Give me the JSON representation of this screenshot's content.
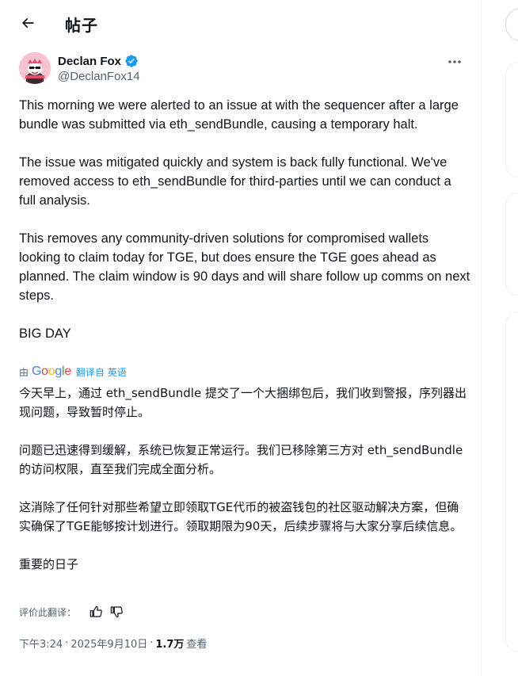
{
  "header": {
    "title": "帖子"
  },
  "author": {
    "display_name": "Declan Fox",
    "handle": "@DeclanFox14",
    "verified": true
  },
  "tweet": {
    "original_paragraphs": [
      "This morning we were alerted to an issue at with the sequencer after a large bundle was submitted via eth_sendBundle, causing a temporary halt.",
      "The issue was mitigated quickly and system is back fully functional. We've removed access to eth_sendBundle for third-parties until we can conduct a full analysis.",
      "This removes any community-driven solutions for compromised wallets looking to claim today for TGE, but does ensure the TGE goes ahead as planned. The claim window is 90 days and will share follow up comms on next steps.",
      "BIG DAY"
    ],
    "translated_by_label": "由",
    "google_text": "Google",
    "translate_from_link": "翻译自 英语",
    "translated_paragraphs": [
      "今天早上，通过 eth_sendBundle 提交了一个大捆绑包后，我们收到警报，序列器出现问题，导致暂时停止。",
      "问题已迅速得到缓解，系统已恢复正常运行。我们已移除第三方对 eth_sendBundle 的访问权限，直至我们完成全面分析。",
      "这消除了任何针对那些希望立即领取TGE代币的被盗钱包的社区驱动解决方案，但确实确保了TGE能够按计划进行。领取期限为90天，后续步骤将与大家分享后续信息。",
      "重要的日子"
    ]
  },
  "rate": {
    "label": "评价此翻译："
  },
  "meta": {
    "time": "下午3:24",
    "sep1": "·",
    "date": "2025年9月10日",
    "sep2": "·",
    "views_count": "1.7万",
    "views_label": "查看"
  },
  "icons": {
    "back": "back-arrow-icon",
    "verified": "verified-badge-icon",
    "more": "more-icon",
    "thumbs_up": "thumbs-up-icon",
    "thumbs_down": "thumbs-down-icon"
  },
  "colors": {
    "accent": "#1d9bf0",
    "secondary_text": "#536471",
    "text": "#0f1419"
  }
}
